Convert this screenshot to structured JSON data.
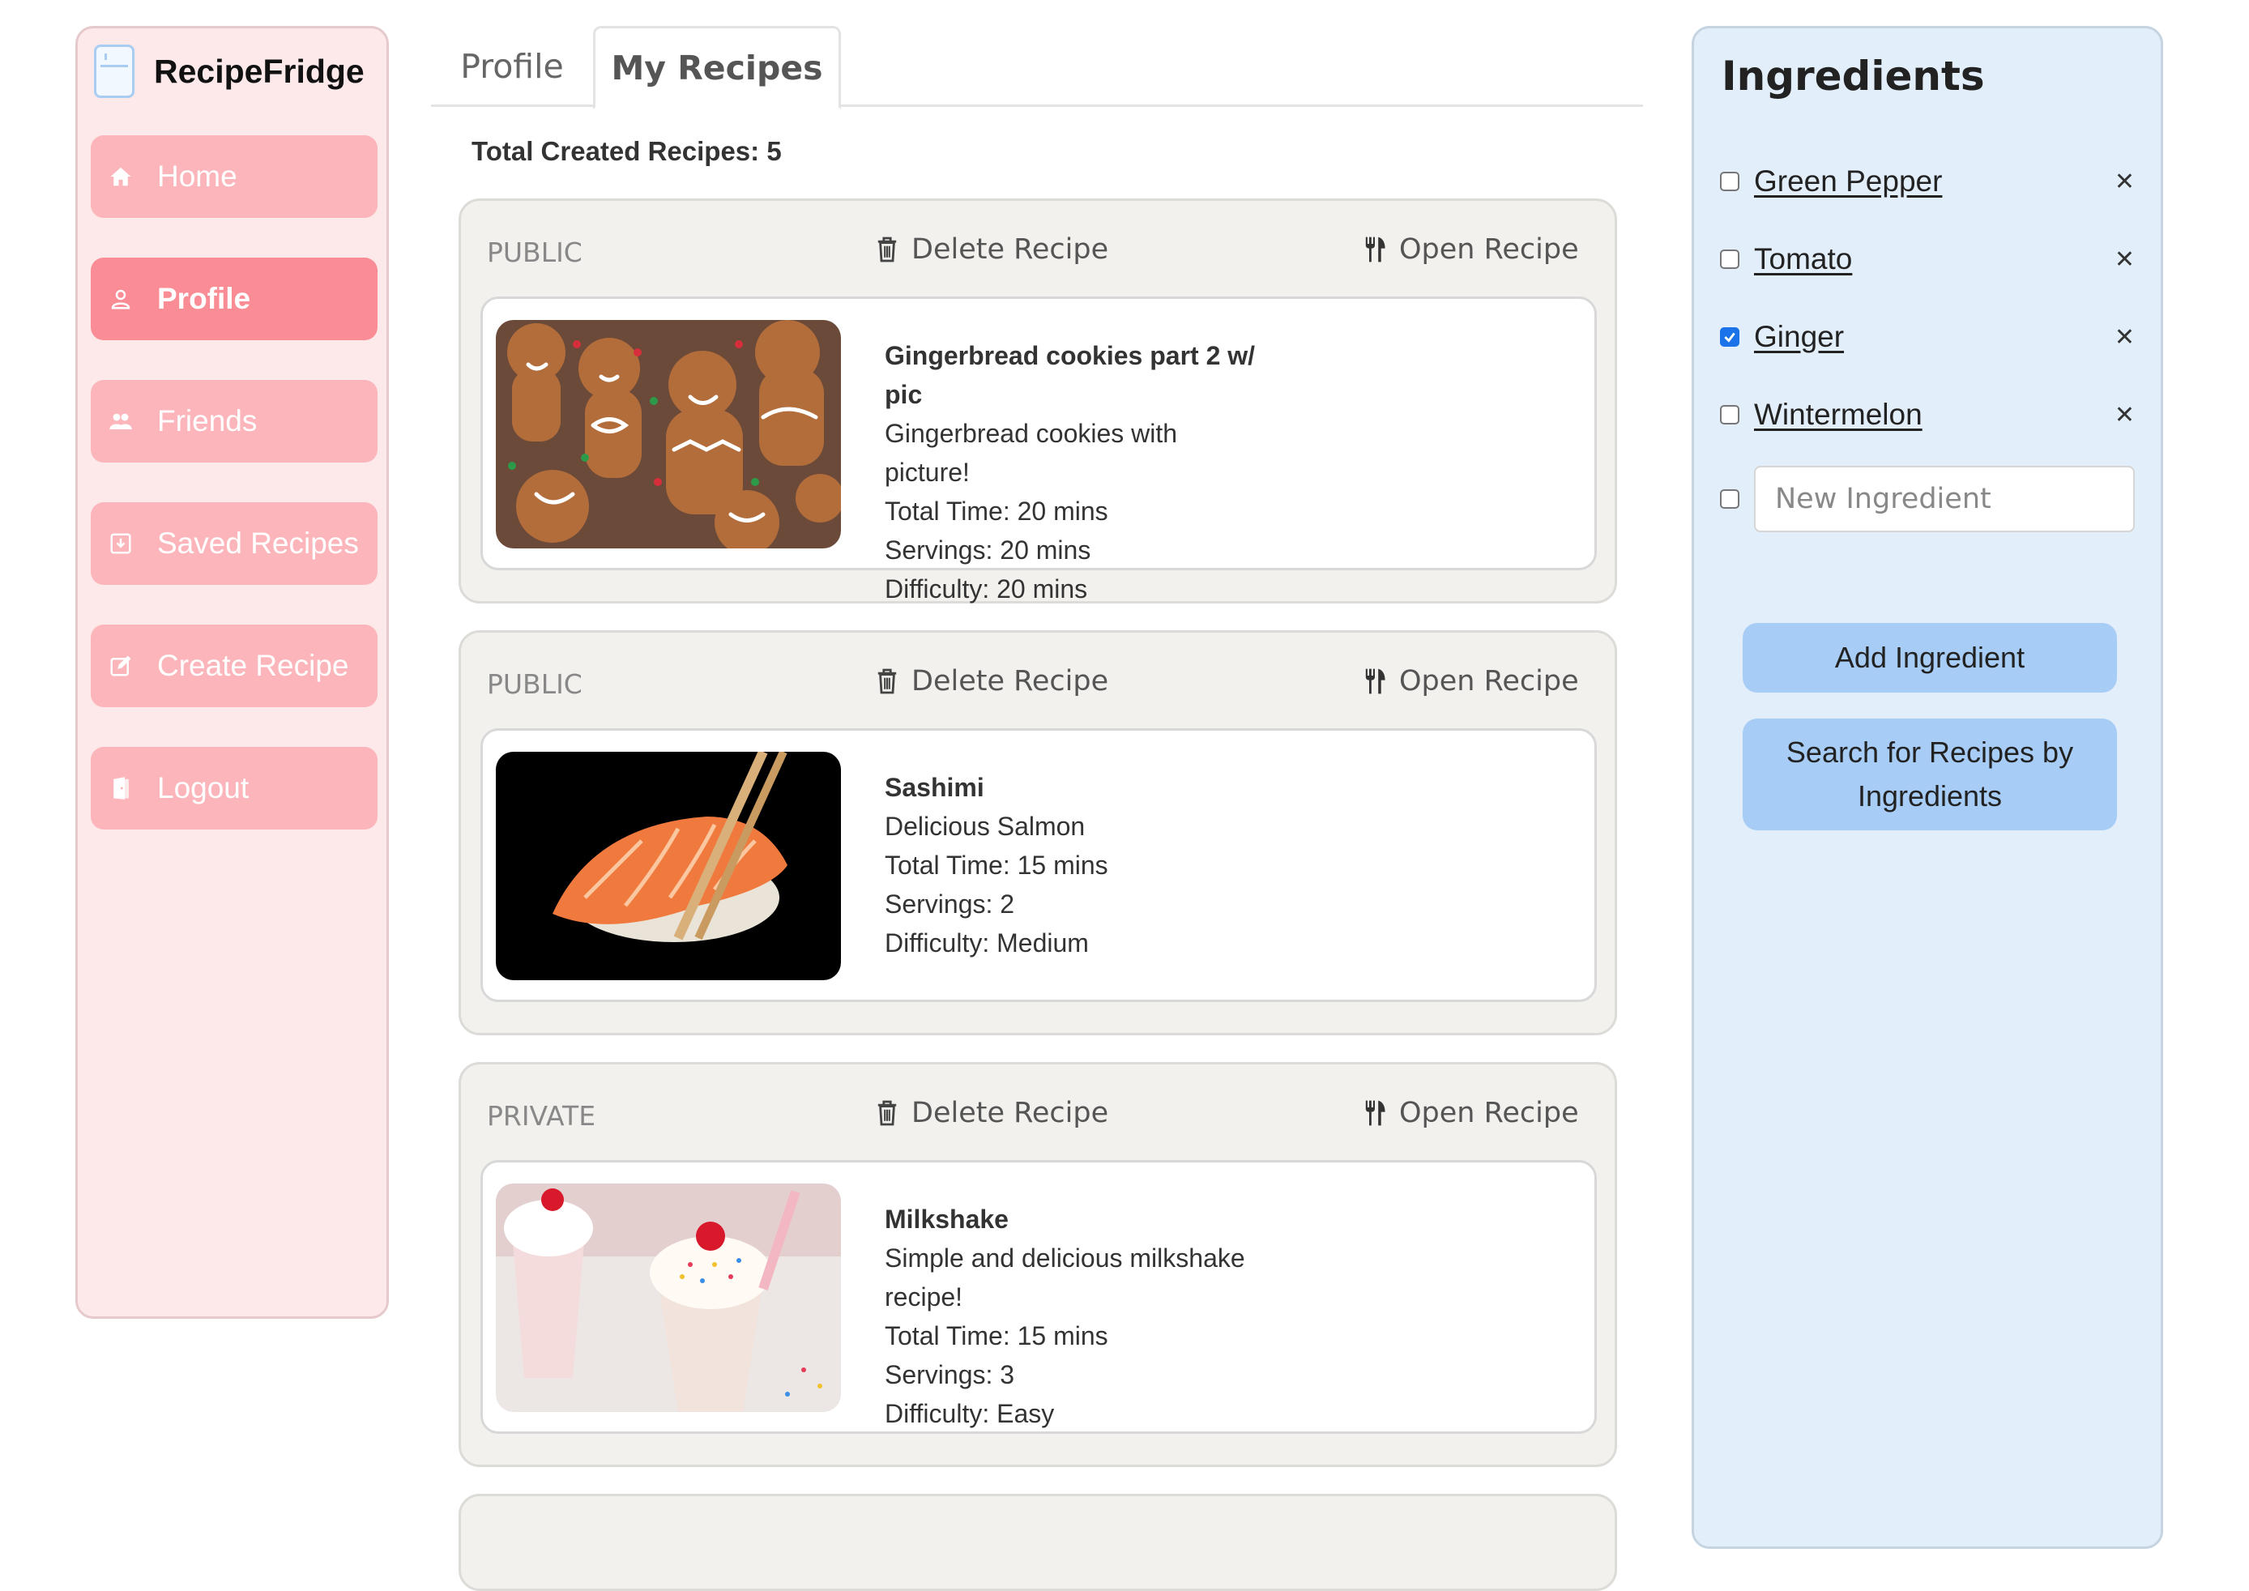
{
  "brand": {
    "name": "RecipeFridge",
    "icon": "fridge-icon"
  },
  "sidebar": {
    "items": [
      {
        "label": "Home",
        "icon": "home-icon",
        "active": false
      },
      {
        "label": "Profile",
        "icon": "user-icon",
        "active": true
      },
      {
        "label": "Friends",
        "icon": "friends-icon",
        "active": false
      },
      {
        "label": "Saved Recipes",
        "icon": "bookmark-icon",
        "active": false
      },
      {
        "label": "Create Recipe",
        "icon": "edit-icon",
        "active": false
      },
      {
        "label": "Logout",
        "icon": "door-icon",
        "active": false
      }
    ]
  },
  "tabs": [
    {
      "label": "Profile",
      "active": false
    },
    {
      "label": "My Recipes",
      "active": true
    }
  ],
  "summary": {
    "total_label": "Total Created Recipes: 5"
  },
  "recipes": [
    {
      "visibility": "PUBLIC",
      "delete_label": "Delete Recipe",
      "open_label": "Open Recipe",
      "title": "Gingerbread cookies part 2 w/ pic",
      "description": "Gingerbread cookies with picture!",
      "total_time": "Total Time: 20 mins",
      "servings": "Servings: 20 mins",
      "difficulty": "Difficulty: 20 mins"
    },
    {
      "visibility": "PUBLIC",
      "delete_label": "Delete Recipe",
      "open_label": "Open Recipe",
      "title": "Sashimi",
      "description": "Delicious Salmon",
      "total_time": "Total Time: 15 mins",
      "servings": "Servings: 2",
      "difficulty": "Difficulty: Medium"
    },
    {
      "visibility": "PRIVATE",
      "delete_label": "Delete Recipe",
      "open_label": "Open Recipe",
      "title": "Milkshake",
      "description": "Simple and delicious milkshake recipe!",
      "total_time": "Total Time: 15 mins",
      "servings": "Servings: 3",
      "difficulty": "Difficulty: Easy"
    }
  ],
  "ingredients": {
    "title": "Ingredients",
    "items": [
      {
        "name": "Green Pepper",
        "checked": false
      },
      {
        "name": "Tomato",
        "checked": false
      },
      {
        "name": "Ginger",
        "checked": true
      },
      {
        "name": "Wintermelon",
        "checked": false
      }
    ],
    "new_placeholder": "New Ingredient",
    "add_button": "Add Ingredient",
    "search_button": "Search for Recipes by Ingredients"
  },
  "colors": {
    "sidebar_bg": "#fde9ea",
    "nav_item": "#fcb6bb",
    "nav_item_active": "#f98c94",
    "panel_bg": "#e3eefb",
    "button_blue": "#a7cdf6",
    "card_bg": "#f2f1ed"
  }
}
